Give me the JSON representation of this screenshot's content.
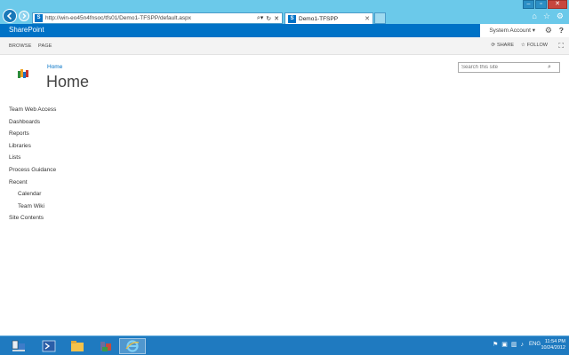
{
  "browser": {
    "url": "http://win-eo45n4fnsoc/tfs01/Demo1-TFSPP/default.aspx",
    "tab_title": "Demo1-TFSPP",
    "site_icon_letter": "S",
    "toolbar_icons": [
      "home-icon",
      "favorites-icon",
      "settings-icon"
    ]
  },
  "suite": {
    "brand": "SharePoint",
    "user": "System Account ▾",
    "accent": "#0072c6"
  },
  "ribbon": {
    "tabs": [
      "BROWSE",
      "PAGE"
    ],
    "share_label": "SHARE",
    "follow_label": "FOLLOW"
  },
  "page": {
    "breadcrumb": "Home",
    "title": "Home",
    "search_placeholder": "Search this site"
  },
  "quick_launch": [
    {
      "label": "Team Web Access",
      "sub": false
    },
    {
      "label": "Dashboards",
      "sub": false
    },
    {
      "label": "Reports",
      "sub": false
    },
    {
      "label": "Libraries",
      "sub": false
    },
    {
      "label": "Lists",
      "sub": false
    },
    {
      "label": "Process Guidance",
      "sub": false
    },
    {
      "label": "Recent",
      "sub": false
    },
    {
      "label": "Calendar",
      "sub": true
    },
    {
      "label": "Team Wiki",
      "sub": true
    },
    {
      "label": "Site Contents",
      "sub": false
    }
  ],
  "taskbar": {
    "language": "ENG",
    "time": "11:54 PM",
    "date": "10/24/2012",
    "apps": [
      "server-manager-icon",
      "powershell-icon",
      "file-explorer-icon",
      "tfs-admin-icon",
      "internet-explorer-icon"
    ]
  }
}
